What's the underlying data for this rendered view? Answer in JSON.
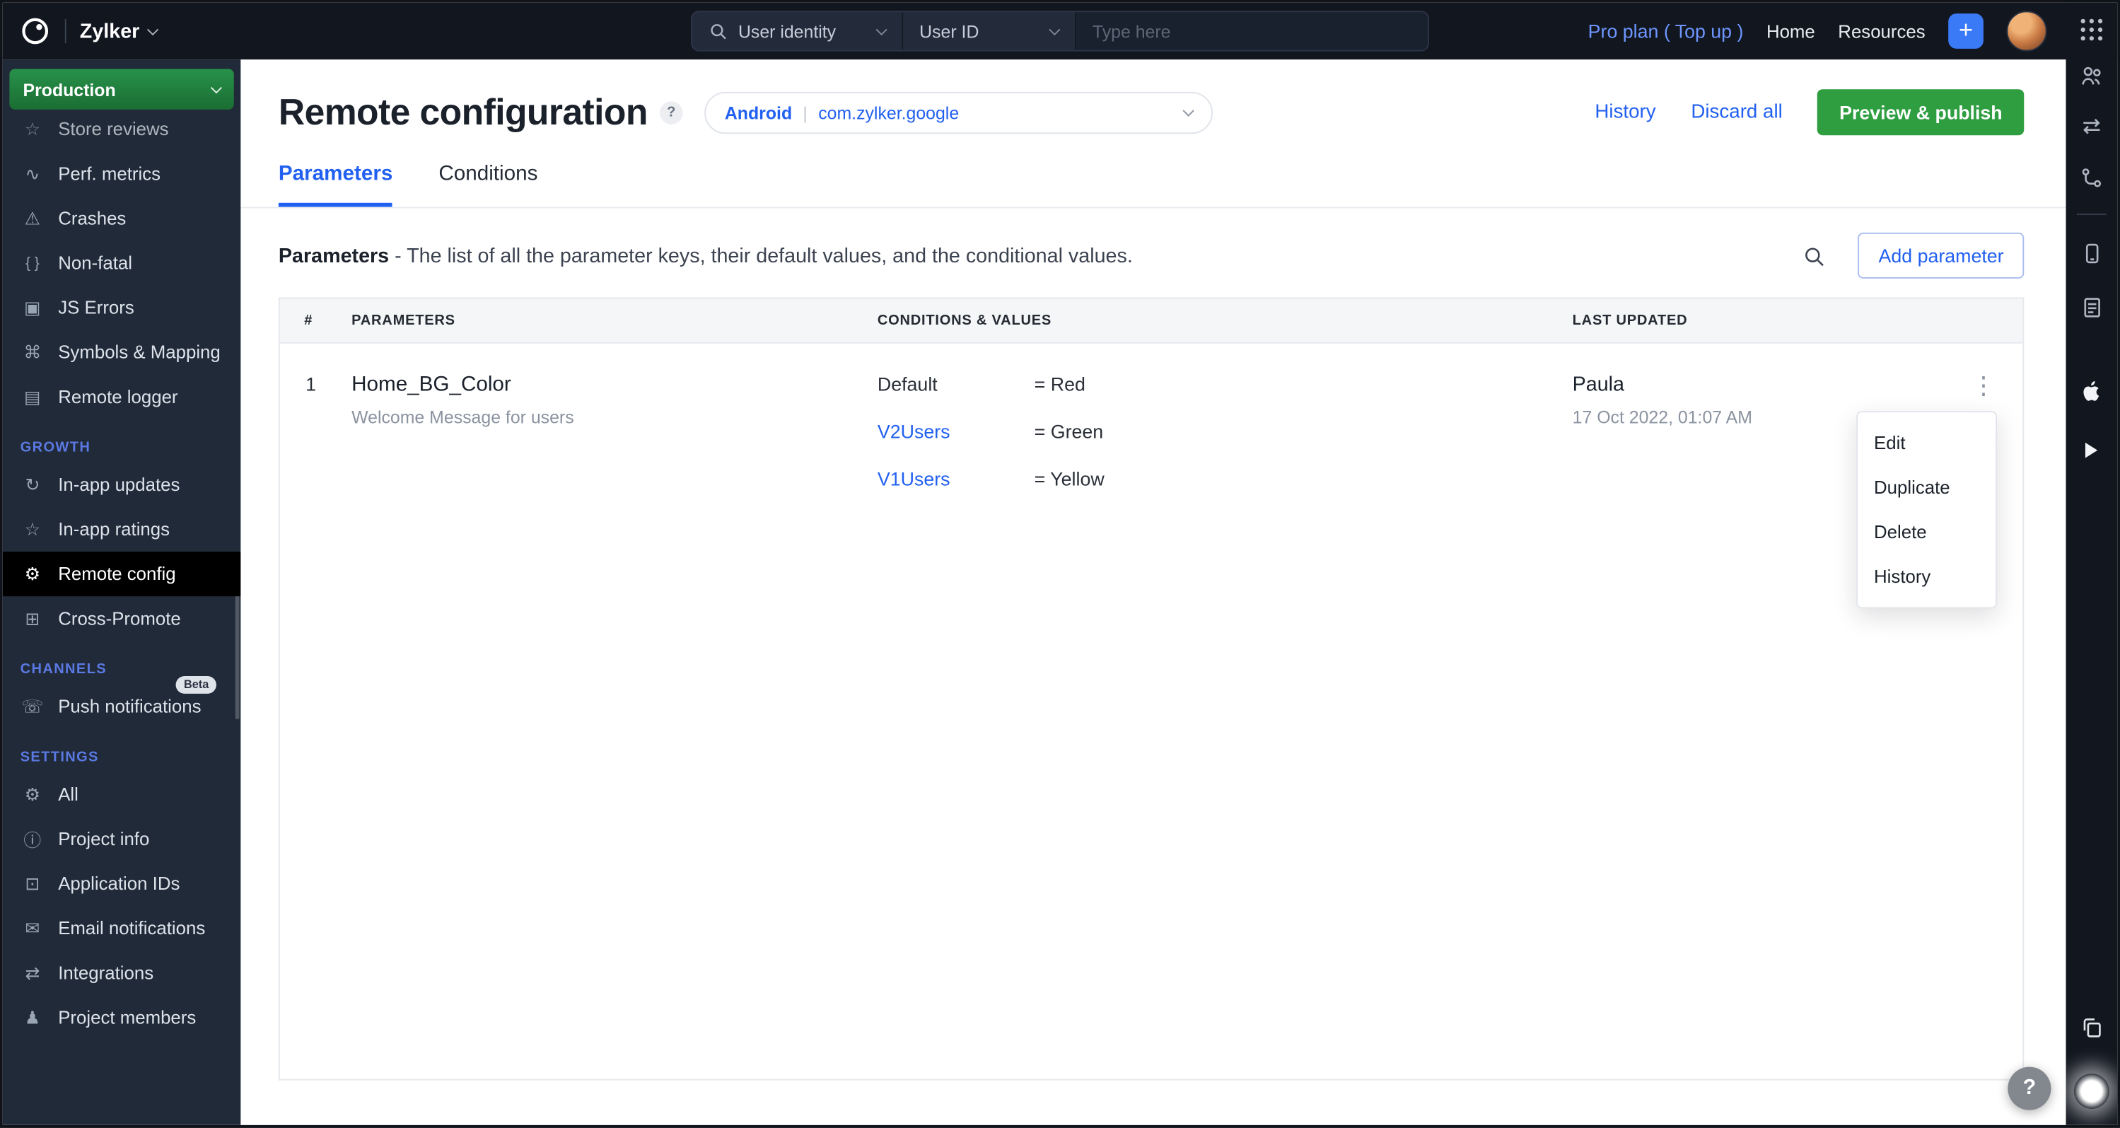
{
  "topbar": {
    "brand": "Zylker",
    "search": {
      "scope_field": "User identity",
      "scope_value": "User ID",
      "placeholder": "Type here"
    },
    "plan_label": "Pro plan",
    "topup_label": "( Top up )",
    "links": {
      "home": "Home",
      "resources": "Resources"
    }
  },
  "sidebar": {
    "environment": "Production",
    "sections": {
      "growth": "GROWTH",
      "channels": "CHANNELS",
      "settings": "SETTINGS"
    },
    "items": [
      {
        "label": "Store reviews",
        "glyph": "☆"
      },
      {
        "label": "Perf. metrics",
        "glyph": "∿"
      },
      {
        "label": "Crashes",
        "glyph": "⚠"
      },
      {
        "label": "Non-fatal",
        "glyph": "{ }"
      },
      {
        "label": "JS Errors",
        "glyph": "▣"
      },
      {
        "label": "Symbols & Mapping",
        "glyph": "⌘"
      },
      {
        "label": "Remote logger",
        "glyph": "▤"
      },
      {
        "label": "In-app updates",
        "glyph": "↻"
      },
      {
        "label": "In-app ratings",
        "glyph": "☆"
      },
      {
        "label": "Remote config",
        "glyph": "⚙"
      },
      {
        "label": "Cross-Promote",
        "glyph": "⊞"
      },
      {
        "label": "Push notifications",
        "glyph": "☏",
        "badge": "Beta"
      },
      {
        "label": "All",
        "glyph": "⚙"
      },
      {
        "label": "Project info",
        "glyph": "ⓘ"
      },
      {
        "label": "Application IDs",
        "glyph": "⊡"
      },
      {
        "label": "Email notifications",
        "glyph": "✉"
      },
      {
        "label": "Integrations",
        "glyph": "⇄"
      },
      {
        "label": "Project members",
        "glyph": "♟"
      }
    ]
  },
  "page": {
    "title": "Remote configuration",
    "help_glyph": "?",
    "app_selector": {
      "platform": "Android",
      "divider": "|",
      "app_id": "com.zylker.google"
    },
    "actions": {
      "history": "History",
      "discard_all": "Discard all",
      "publish": "Preview & publish"
    },
    "tabs": {
      "parameters": "Parameters",
      "conditions": "Conditions"
    },
    "list_header": {
      "heading": "Parameters",
      "description": " - The list of all the parameter keys, their default values, and the conditional values.",
      "add_button": "Add parameter"
    }
  },
  "table": {
    "headers": {
      "index": "#",
      "parameters": "PARAMETERS",
      "conditions": "CONDITIONS & VALUES",
      "updated": "LAST UPDATED"
    },
    "row": {
      "index": "1",
      "name": "Home_BG_Color",
      "description": "Welcome Message for users",
      "conditions": [
        {
          "label": "Default",
          "value": "= Red"
        },
        {
          "label": "V2Users",
          "value": "= Green"
        },
        {
          "label": "V1Users",
          "value": "= Yellow"
        }
      ],
      "updated_by": "Paula",
      "updated_on": "17 Oct 2022, 01:07 AM"
    }
  },
  "context_menu": {
    "items": [
      "Edit",
      "Duplicate",
      "Delete",
      "History"
    ]
  },
  "glyphs": {
    "kebab": "⋮",
    "plus": "+"
  },
  "colors": {
    "accent_blue": "#2160f0",
    "publish_green": "#2e9e41",
    "environment_green": "#1f7c37",
    "topbar_bg": "#12161f",
    "sidebar_bg": "#202a38",
    "active_item_bg": "#000000",
    "section_label_blue": "#5b79e3"
  }
}
